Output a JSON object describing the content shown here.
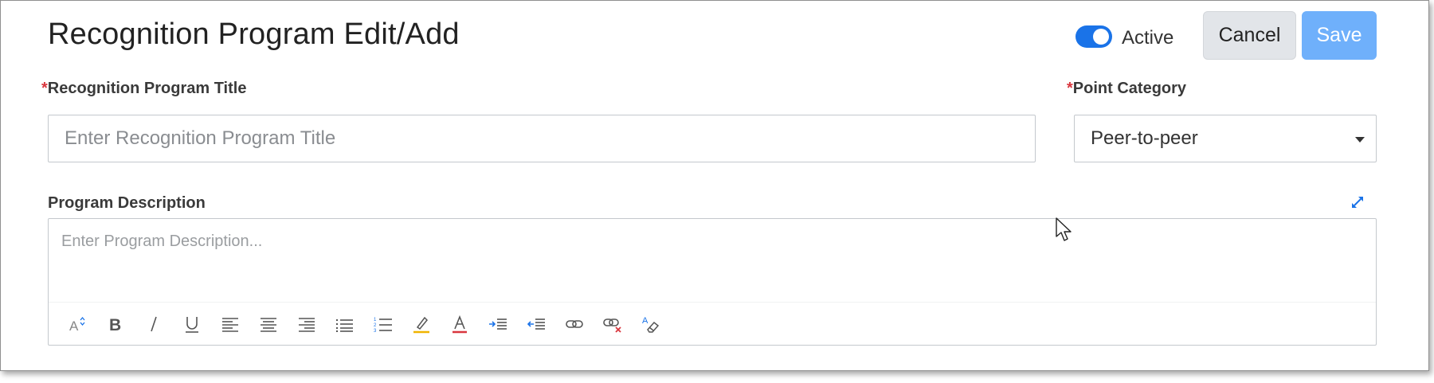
{
  "header": {
    "title": "Recognition Program Edit/Add",
    "active_label": "Active",
    "active_on": true,
    "cancel_label": "Cancel",
    "save_label": "Save"
  },
  "form": {
    "title_field": {
      "required_mark": "*",
      "label": "Recognition Program Title",
      "placeholder": "Enter Recognition Program Title",
      "value": ""
    },
    "point_category": {
      "required_mark": "*",
      "label": "Point Category",
      "selected": "Peer-to-peer"
    },
    "description": {
      "label": "Program Description",
      "placeholder": "Enter Program Description..."
    }
  },
  "toolbar": {
    "icons": [
      "font-size-icon",
      "bold-icon",
      "italic-icon",
      "underline-icon",
      "align-left-icon",
      "align-center-icon",
      "align-right-icon",
      "bulleted-list-icon",
      "numbered-list-icon",
      "highlight-color-icon",
      "font-color-icon",
      "indent-icon",
      "outdent-icon",
      "insert-link-icon",
      "remove-link-icon",
      "clear-formatting-icon"
    ]
  },
  "colors": {
    "toggle_on": "#1a73e8",
    "save_button": "#6fb0fb",
    "required": "#d9363e",
    "highlight_underline": "#f0b400",
    "font_color_underline": "#d9363e"
  }
}
